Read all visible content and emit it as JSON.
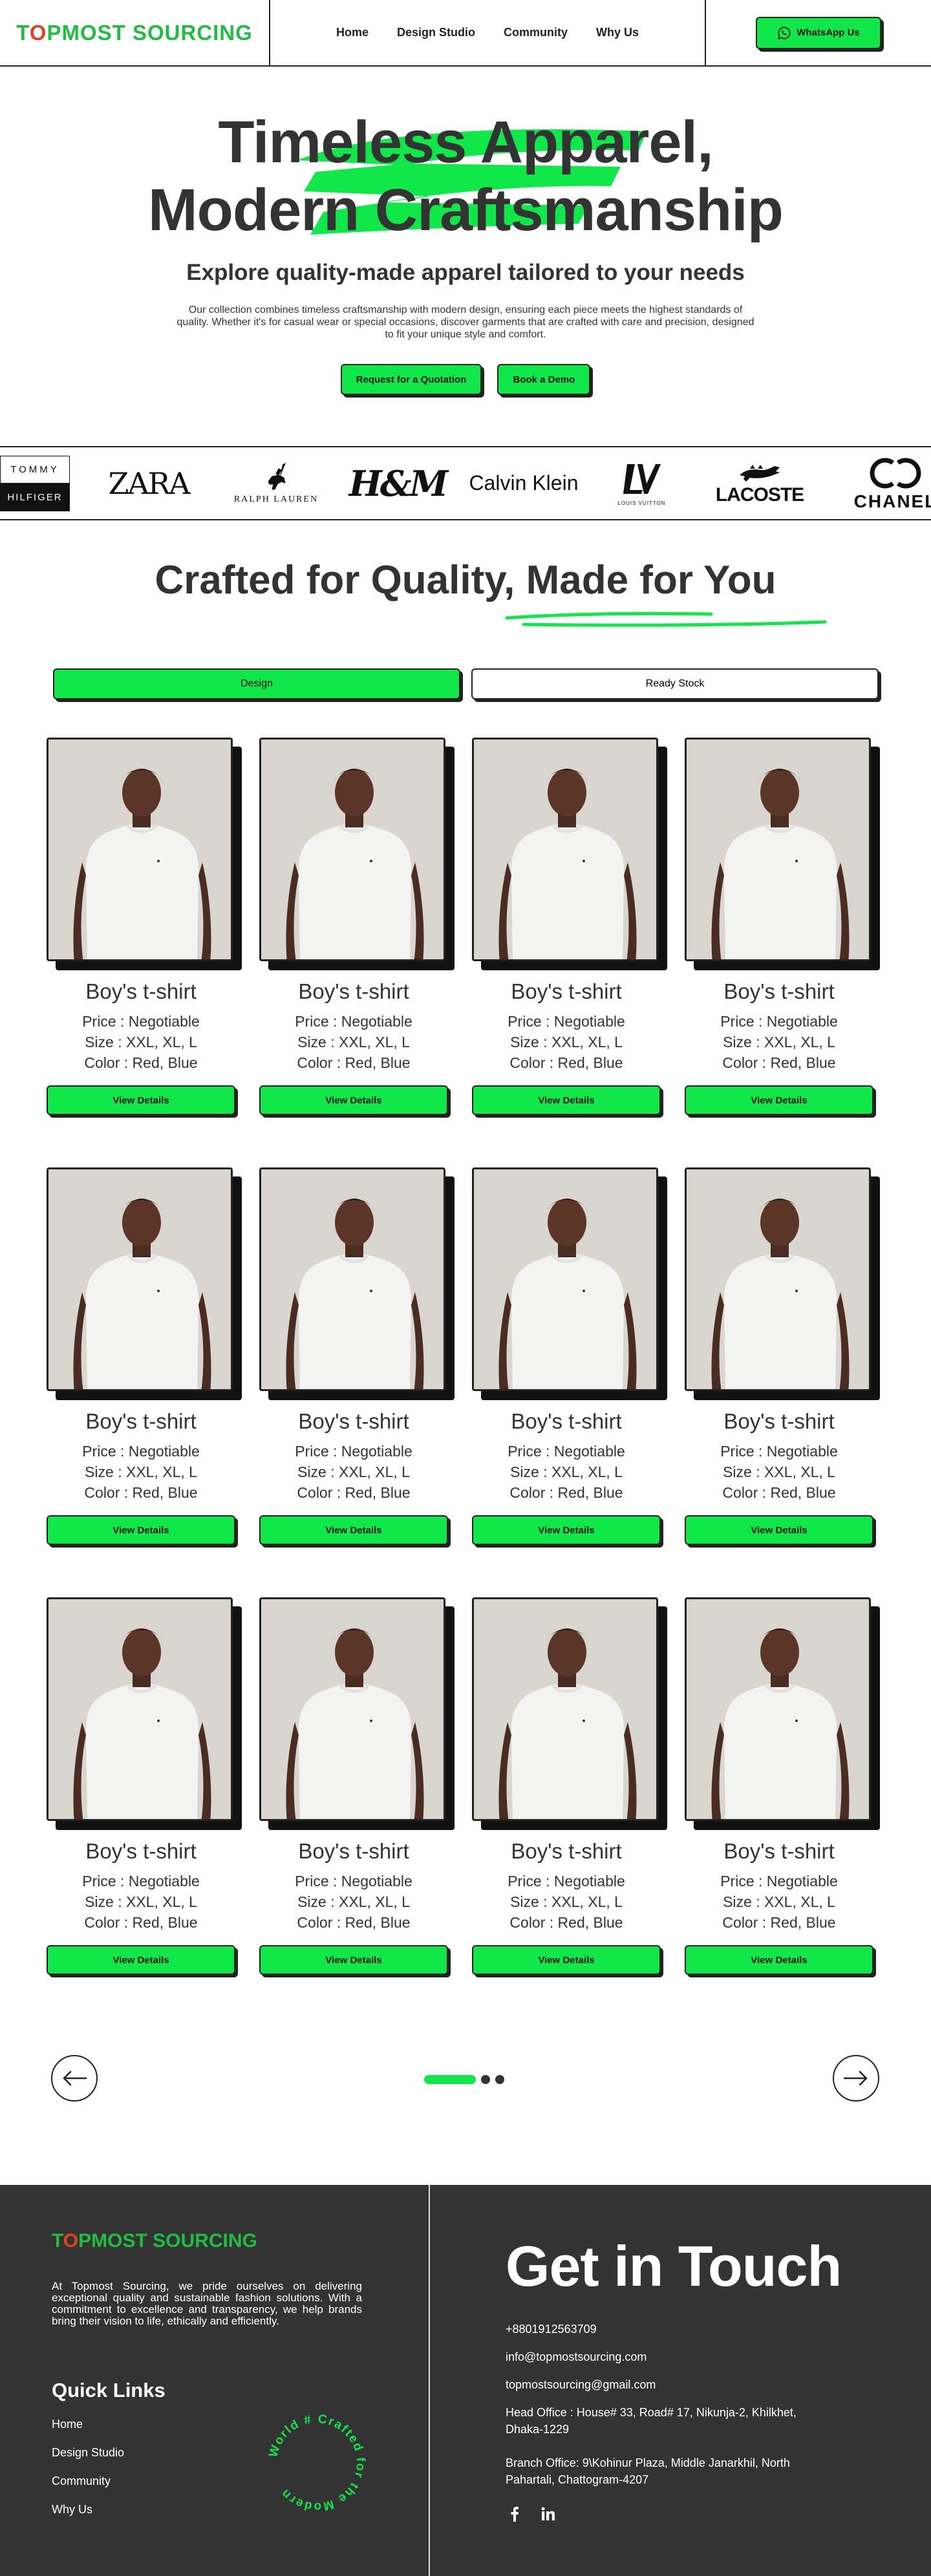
{
  "header": {
    "brand_pre": "T",
    "brand_o": "O",
    "brand_post": "PMOST SOURCING",
    "nav": [
      "Home",
      "Design Studio",
      "Community",
      "Why Us"
    ],
    "cta_label": "WhatsApp Us",
    "cta_icon": "whatsapp-icon"
  },
  "hero": {
    "title_line1": "Timeless Apparel,",
    "title_line2": "Modern Craftsmanship",
    "subtitle": "Explore quality-made apparel tailored to your needs",
    "description": "Our collection combines timeless craftsmanship with modern design, ensuring each piece meets the highest standards of quality. Whether it's for casual wear or special occasions, discover garments that are crafted with care and precision, designed to fit your unique style and comfort.",
    "buttons": [
      "Request for a Quotation",
      "Book a Demo"
    ],
    "accent_color": "#10e849"
  },
  "brands": {
    "tommy_top": "TOMMY",
    "tommy_bottom": "HILFIGER",
    "zara": "ZARA",
    "ralph": "RALPH LAUREN",
    "hm": "H&M",
    "calvin": "Calvin Klein",
    "lv_sub": "LOUIS VUITTON",
    "lacoste": "LACOSTE",
    "chanel": "CHANEL"
  },
  "section": {
    "title": "Crafted for Quality, Made for You",
    "tabs": [
      "Design",
      "Ready Stock"
    ],
    "active_tab": "Design"
  },
  "products": [
    {
      "title": "Boy's t-shirt",
      "price": "Price : Negotiable",
      "size": "Size : XXL, XL, L",
      "color": "Color : Red, Blue",
      "button": "View Details"
    },
    {
      "title": "Boy's t-shirt",
      "price": "Price : Negotiable",
      "size": "Size : XXL, XL, L",
      "color": "Color : Red, Blue",
      "button": "View Details"
    },
    {
      "title": "Boy's t-shirt",
      "price": "Price : Negotiable",
      "size": "Size : XXL, XL, L",
      "color": "Color : Red, Blue",
      "button": "View Details"
    },
    {
      "title": "Boy's t-shirt",
      "price": "Price : Negotiable",
      "size": "Size : XXL, XL, L",
      "color": "Color : Red, Blue",
      "button": "View Details"
    },
    {
      "title": "Boy's t-shirt",
      "price": "Price : Negotiable",
      "size": "Size : XXL, XL, L",
      "color": "Color : Red, Blue",
      "button": "View Details"
    },
    {
      "title": "Boy's t-shirt",
      "price": "Price : Negotiable",
      "size": "Size : XXL, XL, L",
      "color": "Color : Red, Blue",
      "button": "View Details"
    },
    {
      "title": "Boy's t-shirt",
      "price": "Price : Negotiable",
      "size": "Size : XXL, XL, L",
      "color": "Color : Red, Blue",
      "button": "View Details"
    },
    {
      "title": "Boy's t-shirt",
      "price": "Price : Negotiable",
      "size": "Size : XXL, XL, L",
      "color": "Color : Red, Blue",
      "button": "View Details"
    },
    {
      "title": "Boy's t-shirt",
      "price": "Price : Negotiable",
      "size": "Size : XXL, XL, L",
      "color": "Color : Red, Blue",
      "button": "View Details"
    },
    {
      "title": "Boy's t-shirt",
      "price": "Price : Negotiable",
      "size": "Size : XXL, XL, L",
      "color": "Color : Red, Blue",
      "button": "View Details"
    },
    {
      "title": "Boy's t-shirt",
      "price": "Price : Negotiable",
      "size": "Size : XXL, XL, L",
      "color": "Color : Red, Blue",
      "button": "View Details"
    },
    {
      "title": "Boy's t-shirt",
      "price": "Price : Negotiable",
      "size": "Size : XXL, XL, L",
      "color": "Color : Red, Blue",
      "button": "View Details"
    }
  ],
  "pager": {
    "prev_icon": "arrow-left-icon",
    "next_icon": "arrow-right-icon",
    "pages": 3,
    "active_page": 1
  },
  "footer": {
    "brand_pre": "T",
    "brand_o": "O",
    "brand_post": "PMOST SOURCING",
    "about": "At Topmost Sourcing, we pride ourselves on delivering exceptional quality and sustainable fashion solutions. With a commitment to excellence and transparency, we help brands bring their vision to life, ethically and efficiently.",
    "quick_links_title": "Quick Links",
    "quick_links": [
      "Home",
      "Design Studio",
      "Community",
      "Why Us"
    ],
    "circle_text": "World # Crafted for the Modern",
    "contact_title": "Get in Touch",
    "phone": "+8801912563709",
    "email1": "info@topmostsourcing.com",
    "email2": "topmostsourcing@gmail.com",
    "head_office": "Head Office : House# 33, Road# 17, Nikunja-2, Khilkhet, Dhaka-1229",
    "branch_office": "Branch Office: 9\\Kohinur Plaza, Middle Janarkhil, North Pahartali, Chattogram-4207",
    "social_icons": [
      "facebook-icon",
      "linkedin-icon"
    ]
  }
}
